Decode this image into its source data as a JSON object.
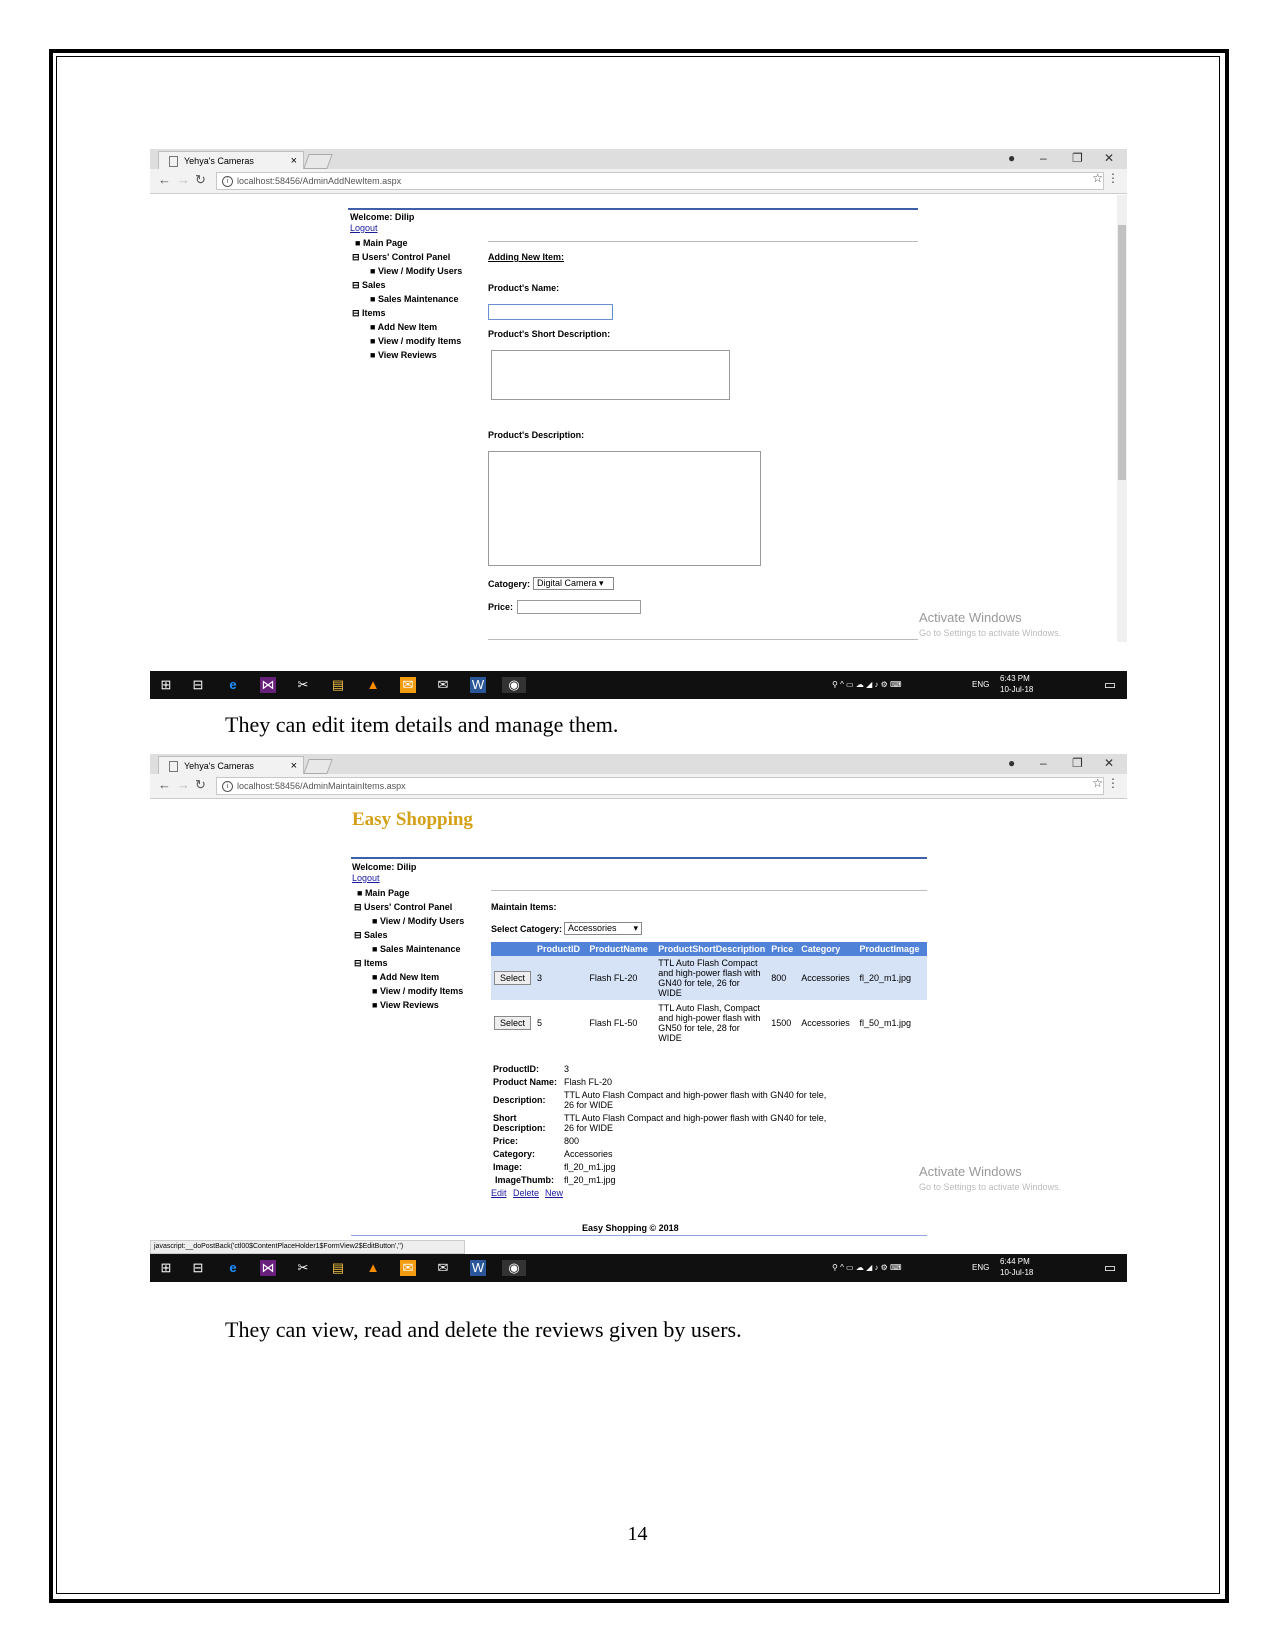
{
  "screenshot1": {
    "tab_title": "Yehya's Cameras",
    "url": "localhost:58456/AdminAddNewItem.aspx",
    "welcome": "Welcome: Dilip",
    "logout": "Logout",
    "menu": {
      "main_page": "Main Page",
      "users_panel": "Users' Control Panel",
      "view_modify_users": "View / Modify Users",
      "sales": "Sales",
      "sales_maintenance": "Sales Maintenance",
      "items": "Items",
      "add_new_item": "Add New Item",
      "view_modify_items": "View / modify Items",
      "view_reviews": "View Reviews"
    },
    "form": {
      "heading": "Adding New Item:",
      "name_label": "Product's Name:",
      "short_desc_label": "Product's Short Description:",
      "desc_label": "Product's Description:",
      "category_label": "Catogery:",
      "category_value": "Digital Camera",
      "price_label": "Price:"
    },
    "watermark_title": "Activate Windows",
    "watermark_sub": "Go to Settings to activate Windows.",
    "tray": {
      "lang": "ENG",
      "time": "6:43 PM",
      "date": "10-Jul-18"
    }
  },
  "caption1": "They can edit item details and manage them.",
  "screenshot2": {
    "tab_title": "Yehya's Cameras",
    "url": "localhost:58456/AdminMaintainItems.aspx",
    "site_title": "Easy Shopping",
    "welcome": "Welcome: Dilip",
    "logout": "Logout",
    "menu": {
      "main_page": "Main Page",
      "users_panel": "Users' Control Panel",
      "view_modify_users": "View / Modify Users",
      "sales": "Sales",
      "sales_maintenance": "Sales Maintenance",
      "items": "Items",
      "add_new_item": "Add New Item",
      "view_modify_items": "View / modify Items",
      "view_reviews": "View Reviews"
    },
    "maintain_label": "Maintain Items:",
    "select_category_label": "Select Catogery:",
    "select_category_value": "Accessories",
    "grid": {
      "headers": [
        "",
        "ProductID",
        "ProductName",
        "ProductShortDescription",
        "Price",
        "Category",
        "ProductImage"
      ],
      "select_label": "Select",
      "rows": [
        {
          "id": "3",
          "name": "Flash FL-20",
          "short": "TTL Auto Flash Compact and high-power flash with GN40 for tele, 26 for WIDE",
          "price": "800",
          "category": "Accessories",
          "image": "fl_20_m1.jpg"
        },
        {
          "id": "5",
          "name": "Flash FL-50",
          "short": "TTL Auto Flash, Compact and high-power flash with GN50 for tele, 28 for WIDE",
          "price": "1500",
          "category": "Accessories",
          "image": "fl_50_m1.jpg"
        }
      ]
    },
    "details": {
      "labels": {
        "id": "ProductID:",
        "name": "Product Name:",
        "desc": "Description:",
        "short1": "Short",
        "short2": "Description:",
        "price": "Price:",
        "category": "Category:",
        "image": "Image:",
        "thumb": "ImageThumb:"
      },
      "values": {
        "id": "3",
        "name": "Flash FL-20",
        "desc1": "TTL Auto Flash Compact and high-power flash with GN40 for tele,",
        "desc2": "26 for WIDE",
        "short1": "TTL Auto Flash Compact and high-power flash with GN40 for tele,",
        "short2": "26 for WIDE",
        "price": "800",
        "category": "Accessories",
        "image": "fl_20_m1.jpg",
        "thumb": "fl_20_m1.jpg"
      },
      "edit": "Edit",
      "delete": "Delete",
      "new": "New"
    },
    "footer": "Easy Shopping  © 2018",
    "status_bar": "javascript:__doPostBack('ctl00$ContentPlaceHolder1$FormView2$EditButton','')",
    "watermark_title": "Activate Windows",
    "watermark_sub": "Go to Settings to activate Windows.",
    "tray": {
      "lang": "ENG",
      "time": "6:44 PM",
      "date": "10-Jul-18"
    }
  },
  "caption2": "They can view, read and delete the reviews given by users.",
  "page_number": "14"
}
